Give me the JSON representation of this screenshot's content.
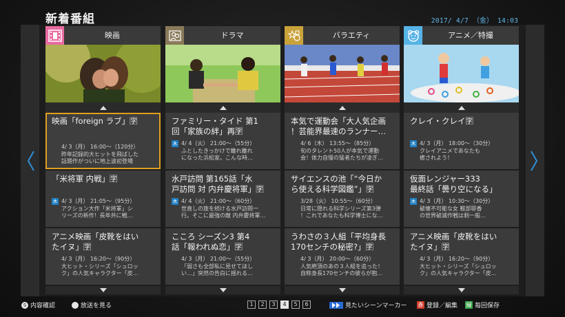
{
  "header": {
    "title": "新着番組",
    "datetime": "2017/ 4/7 （金） 14:03"
  },
  "colors": {
    "accent_selected": "#e0a01e",
    "badge_blue": "#1f7ec2",
    "movie": "#e86aa0",
    "drama": "#8a7a5a",
    "variety": "#c9a23a",
    "anime": "#56b3e6",
    "footer_red": "#d23a2a",
    "footer_green": "#3aa34a",
    "footer_blue": "#2a6ad6"
  },
  "columns": [
    {
      "label": "映画",
      "icon": "film-icon",
      "items": [
        {
          "title": "映画「foreign ラブ」🈑",
          "meta": "4/ 3（月） 16:00～（120分）",
          "desc": "昨年記録的大ヒットを飛ばした\n話題作がついに地上波初登場",
          "badge": ""
        },
        {
          "title": "「米将軍 内戦」🈑",
          "meta": "4/ 3（月） 21:05～（95分）",
          "desc": "アクション大作「米将軍」シ\nリーズの新作！長年共に戦…",
          "badge": "木"
        },
        {
          "title": "アニメ映画「皮靴をはい\nたイヌ」🈑",
          "meta": "4/ 3（月） 16:20～（90分）",
          "desc": "大ヒット・シリーズ「シュロッ\nク」の人気キャラクター「皮…",
          "badge": ""
        }
      ]
    },
    {
      "label": "ドラマ",
      "icon": "drama-icon",
      "items": [
        {
          "title": "ファミリー・タイド 第1\n回「家族の絆」再🈑",
          "meta": "4/ 4（火） 21:00～（55分）",
          "desc": "ふとしたきっかけで離れ離れ\nになった浜松家。こんな時…",
          "badge": "木"
        },
        {
          "title": "水戸訪問 第165話「水\n戸訪問 対 内弁慶将軍」🈑",
          "meta": "4/ 4（火） 21:00～（60分）",
          "desc": "世直しの旅を続ける水戸訪問一\n行。そこに最強の敵 内弁慶将軍…",
          "badge": "木"
        },
        {
          "title": "こころ シーズン3 第4\n話「報われぬ恋」🈑",
          "meta": "4/ 3（月） 21:00～（55分）",
          "desc": "「弱さも全部私に見せてほし\nい…」突然の告白に揺れる…",
          "badge": ""
        }
      ]
    },
    {
      "label": "バラエティ",
      "icon": "variety-icon",
      "items": [
        {
          "title": "本気で運動会「大人気企画\n！芸能界最速のランナー…",
          "meta": "4/ 6（木） 13:55～（85分）",
          "desc": "旬のタレント50人が本気で運動\n会！体力自慢の猛者たちが凌ぎ…",
          "badge": ""
        },
        {
          "title": "サイエンスの池「“今日か\nら使える科学図鑑”」🈑",
          "meta": "3/28（火） 10:55～（60分）",
          "desc": "日常に隠れる科学シリーズ第3弾\n！これであなたも科学博士にな…",
          "badge": ""
        },
        {
          "title": "うわさの３人組「平均身長\n170センチの秘密?」🈑",
          "meta": "4/ 3（月） 20:00～（60分）",
          "desc": "人気絶頂のあの３人組を追った！\n自称身長170センチの彼らが抱…",
          "badge": ""
        }
      ]
    },
    {
      "label": "アニメ／特撮",
      "icon": "anime-icon",
      "items": [
        {
          "title": "クレイ・クレイ🈑",
          "meta": "4/ 3（月） 18:00～（30分）",
          "desc": "クレイアニメであなたも\n癒されよう！",
          "badge": "木"
        },
        {
          "title": "仮面レンジャー333\n最終話「曇り空になる」",
          "meta": "4/ 3（月） 10:30～（30分）",
          "desc": "破壊不可能な女 鞍部耶香\nの世界破滅作戦は剣一般…",
          "badge": "木"
        },
        {
          "title": "アニメ映画「皮靴をはい\nたイヌ」🈑",
          "meta": "4/ 3（月） 16:20～（90分）",
          "desc": "大ヒット・シリーズ「シュロッ\nク」の人気キャラクター「皮…",
          "badge": ""
        }
      ]
    }
  ],
  "footer": {
    "info": "内容確認",
    "info_key": "S",
    "watch": "放送を見る",
    "pages": [
      "1",
      "2",
      "3",
      "4",
      "5",
      "6"
    ],
    "selected_page": "4",
    "marker": "見たいシーンマーカー",
    "red_key": "赤",
    "register": "登録／編集",
    "green_key": "緑",
    "every": "毎回保存"
  }
}
